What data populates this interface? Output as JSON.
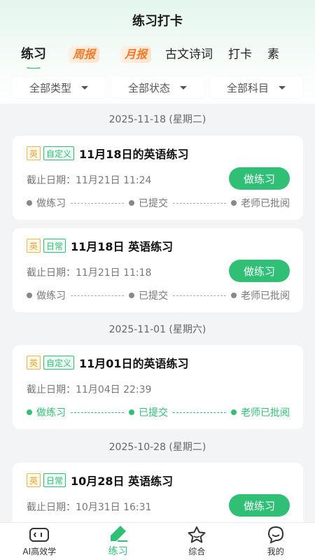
{
  "header": {
    "title": "练习打卡"
  },
  "tabs": [
    {
      "label": "练习",
      "active": true
    },
    {
      "label": "周报",
      "badge": true
    },
    {
      "label": "月报",
      "badge": true
    },
    {
      "label": "古文诗词"
    },
    {
      "label": "打卡"
    },
    {
      "label": "素"
    }
  ],
  "filters": [
    {
      "label": "全部类型"
    },
    {
      "label": "全部状态"
    },
    {
      "label": "全部科目"
    }
  ],
  "groups": [
    {
      "date": "2025-11-18 (星期二)",
      "cards": [
        {
          "subject": "英",
          "tag": "自定义",
          "title": "11月18日的英语练习",
          "deadline": "截止日期：11月21日 11:24",
          "button": "做练习",
          "steps": [
            "做练习",
            "已提交",
            "老师已批阅"
          ],
          "done": false
        },
        {
          "subject": "英",
          "tag": "日常",
          "title": "11月18日 英语练习",
          "deadline": "截止日期：11月21日 11:18",
          "button": "做练习",
          "steps": [
            "做练习",
            "已提交",
            "老师已批阅"
          ],
          "done": false
        }
      ]
    },
    {
      "date": "2025-11-01 (星期六)",
      "cards": [
        {
          "subject": "英",
          "tag": "自定义",
          "title": "11月01日的英语练习",
          "deadline": "截止日期：11月04日 22:39",
          "button": "",
          "steps": [
            "做练习",
            "已提交",
            "老师已批阅"
          ],
          "done": true
        }
      ]
    },
    {
      "date": "2025-10-28 (星期二)",
      "cards": [
        {
          "subject": "英",
          "tag": "日常",
          "title": "10月28日 英语练习",
          "deadline": "截止日期：10月31日 16:31",
          "button": "做练习",
          "steps": [
            "做练习",
            "已提交",
            "老师已批阅"
          ],
          "done": false
        }
      ]
    }
  ],
  "nav": [
    {
      "label": "AI高效学",
      "icon": "ai-robot-icon"
    },
    {
      "label": "练习",
      "icon": "pencil-icon",
      "active": true
    },
    {
      "label": "综合",
      "icon": "star-icon"
    },
    {
      "label": "我的",
      "icon": "profile-icon"
    }
  ],
  "colors": {
    "accent": "#2fbf75",
    "badge": "#f07a2c",
    "subject": "#e9a23b"
  }
}
